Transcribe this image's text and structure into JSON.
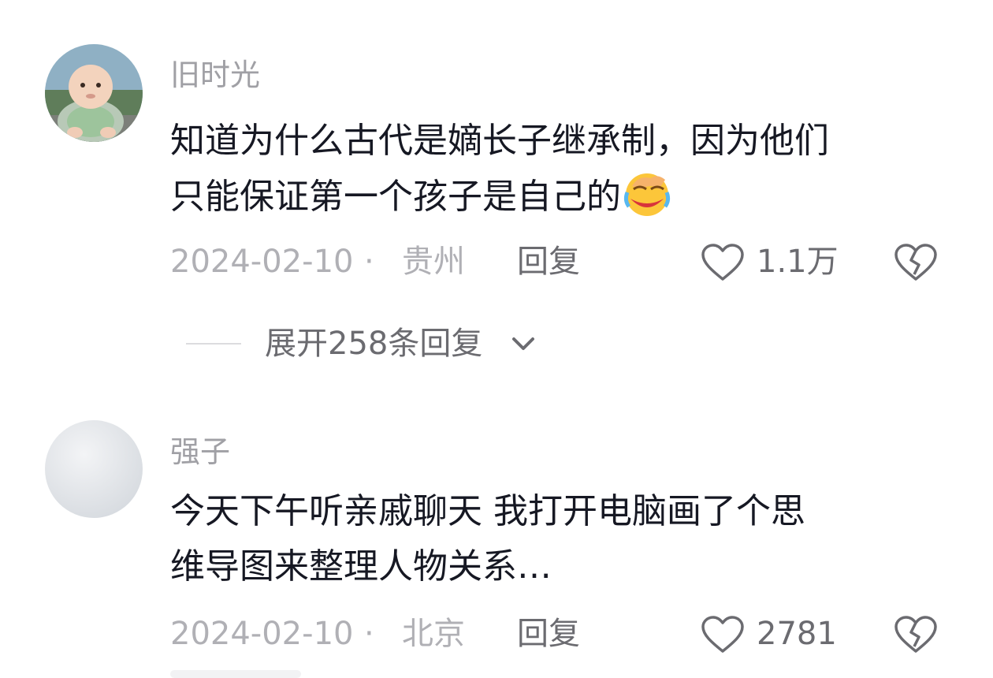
{
  "comments": [
    {
      "username": "旧时光",
      "text_lines": [
        "知道为什么古代是嫡长子继承制，因为他们",
        "只能保证第一个孩子是自己的"
      ],
      "emoji": "laughing-crying-emoji",
      "date": "2024-02-10",
      "separator": "·",
      "location": "贵州",
      "reply_label": "回复",
      "like_count": "1.1万",
      "avatar": "baby-photo-avatar"
    },
    {
      "username": "强子",
      "text_lines": [
        "今天下午听亲戚聊天 我打开电脑画了个思",
        "维导图来整理人物关系…"
      ],
      "date": "2024-02-10",
      "separator": "·",
      "location": "北京",
      "reply_label": "回复",
      "like_count": "2781",
      "avatar": "blank-gray-avatar"
    }
  ],
  "expand_replies": {
    "label": "展开258条回复",
    "icon": "chevron-down-icon"
  },
  "icons": {
    "like": "heart-outline-icon",
    "dislike": "broken-heart-icon"
  },
  "colors": {
    "primary_text": "#161823",
    "secondary_text": "#a0a0a5",
    "action_text": "#6b6b70",
    "background": "#ffffff"
  }
}
